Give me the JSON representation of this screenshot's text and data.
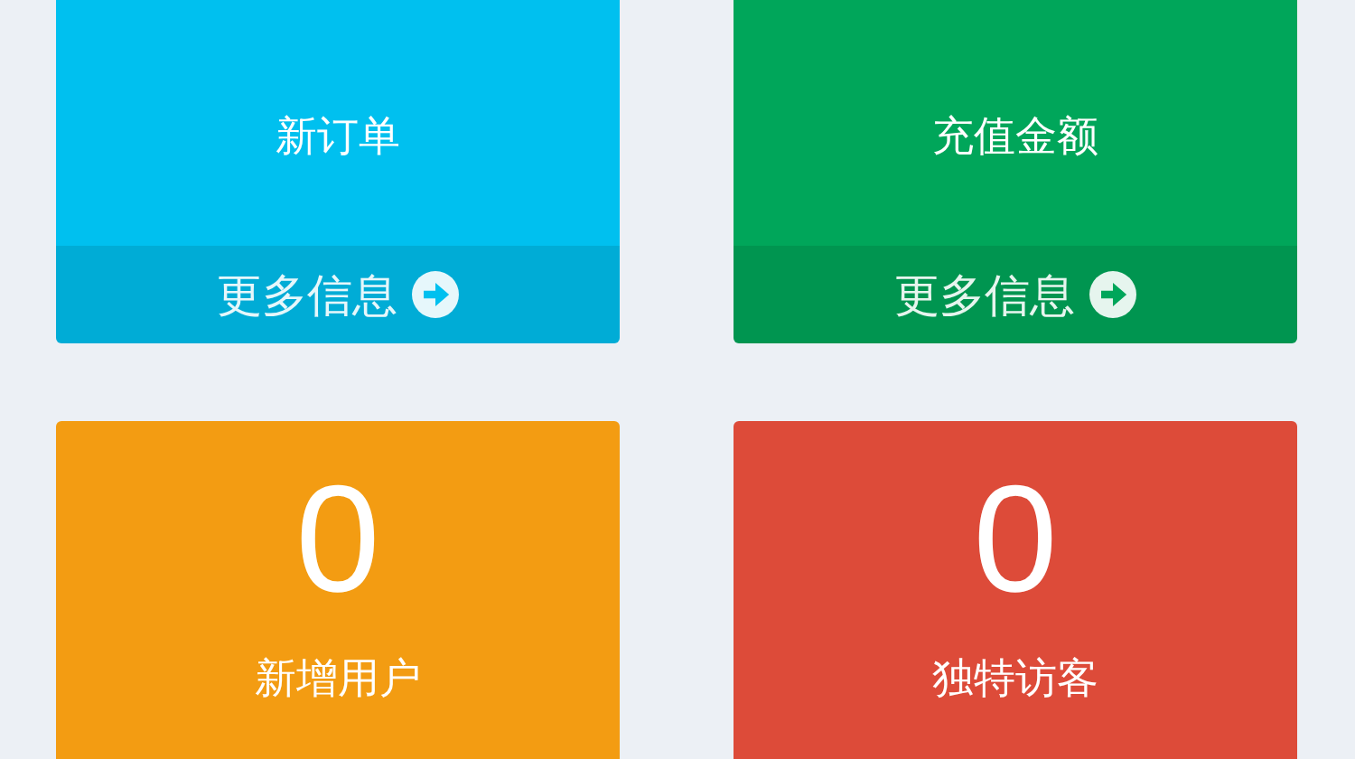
{
  "cards": [
    {
      "label": "新订单",
      "color": "#00c0ef",
      "footer": "更多信息"
    },
    {
      "label": "充值金额",
      "color": "#00a65a",
      "footer": "更多信息"
    },
    {
      "value": "0",
      "label": "新增用户",
      "color": "#f39c12"
    },
    {
      "value": "0",
      "label": "独特访客",
      "color": "#dd4b39"
    }
  ]
}
